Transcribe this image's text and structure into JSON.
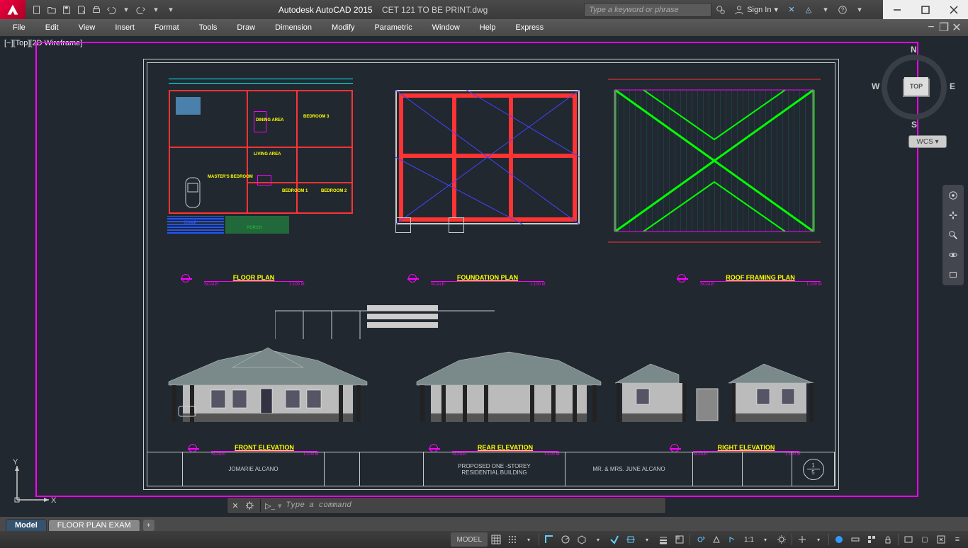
{
  "title": {
    "app": "Autodesk AutoCAD 2015",
    "file": "CET 121 TO BE PRINT.dwg"
  },
  "search": {
    "placeholder": "Type a keyword or phrase"
  },
  "signin": {
    "label": "Sign In"
  },
  "menus": [
    "File",
    "Edit",
    "View",
    "Insert",
    "Format",
    "Tools",
    "Draw",
    "Dimension",
    "Modify",
    "Parametric",
    "Window",
    "Help",
    "Express"
  ],
  "viewport": {
    "label": "[−][Top][2D Wireframe]"
  },
  "viewcube": {
    "top": "TOP",
    "n": "N",
    "s": "S",
    "e": "E",
    "w": "W",
    "wcs": "WCS ▾"
  },
  "ucs": {
    "x": "X",
    "y": "Y"
  },
  "plans": {
    "floor": {
      "title": "FLOOR PLAN",
      "scale": "SCALE:",
      "ratio": "1:100 M"
    },
    "foundation": {
      "title": "FOUNDATION PLAN",
      "scale": "SCALE:",
      "ratio": "1:100 M"
    },
    "roof": {
      "title": "ROOF FRAMING PLAN",
      "scale": "SCALE:",
      "ratio": "1:100 M"
    },
    "front": {
      "title": "FRONT ELEVATION",
      "scale": "SCALE:",
      "ratio": "1:100 M"
    },
    "rear": {
      "title": "REAR ELEVATION",
      "scale": "SCALE:",
      "ratio": "1:100 M"
    },
    "right": {
      "title": "RIGHT ELEVATION",
      "scale": "SCALE:",
      "ratio": "1:100 M"
    }
  },
  "rooms": {
    "dining": "DINING\nAREA",
    "bed3": "BEDROOM 3",
    "living": "LIVING AREA",
    "master": "MASTER'S\nBEDROOM",
    "bed1": "BEDROOM 1",
    "bed2": "BEDROOM 2",
    "ramp": "RAMP",
    "porch": "PORCH"
  },
  "titleblock": {
    "drawn": "JOMARIE ALCANO",
    "project": "PROPOSED ONE -STOREY\nRESIDENTIAL BUILDING",
    "owner": "MR. & MRS. JUNE ALCANO",
    "sheet_num": "1",
    "sheet_total": "5"
  },
  "cmdline": {
    "prompt": "Type a command"
  },
  "tabs": {
    "model": "Model",
    "layout1": "FLOOR PLAN EXAM"
  },
  "statusbar": {
    "model": "MODEL",
    "scale": "1:1"
  }
}
